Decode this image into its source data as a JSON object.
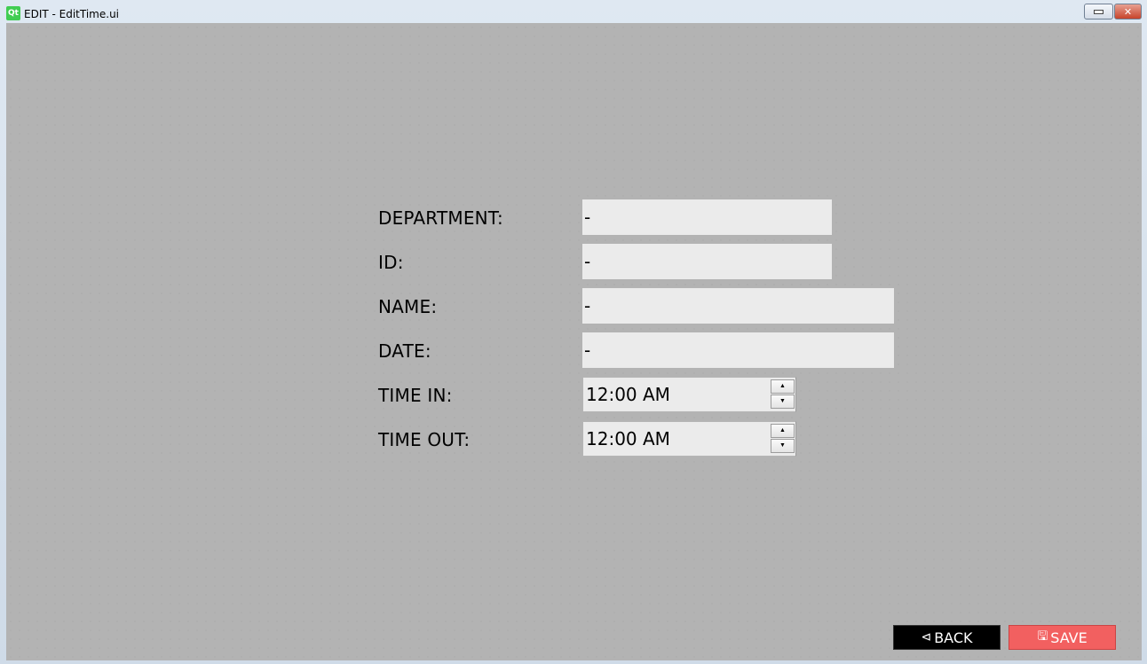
{
  "window": {
    "title": "EDIT - EditTime.ui",
    "logo_text": "Qt",
    "minimize_glyph": "",
    "close_glyph": "✕"
  },
  "form": {
    "department": {
      "label": "DEPARTMENT:",
      "value": "-"
    },
    "id": {
      "label": "ID:",
      "value": "-"
    },
    "name": {
      "label": "NAME:",
      "value": "-"
    },
    "date": {
      "label": "DATE:",
      "value": "-"
    },
    "time_in": {
      "label": "TIME IN:",
      "value": "12:00 AM"
    },
    "time_out": {
      "label": "TIME OUT:",
      "value": "12:00 AM"
    }
  },
  "spin": {
    "up_glyph": "▲",
    "down_glyph": "▼"
  },
  "buttons": {
    "back": {
      "label": "BACK",
      "icon": "⊲"
    },
    "save": {
      "label": "SAVE",
      "icon": "🖫"
    }
  },
  "colors": {
    "background": "#b3b3b3",
    "field": "#ebebeb",
    "back_button": "#000000",
    "save_button": "#f26060"
  }
}
